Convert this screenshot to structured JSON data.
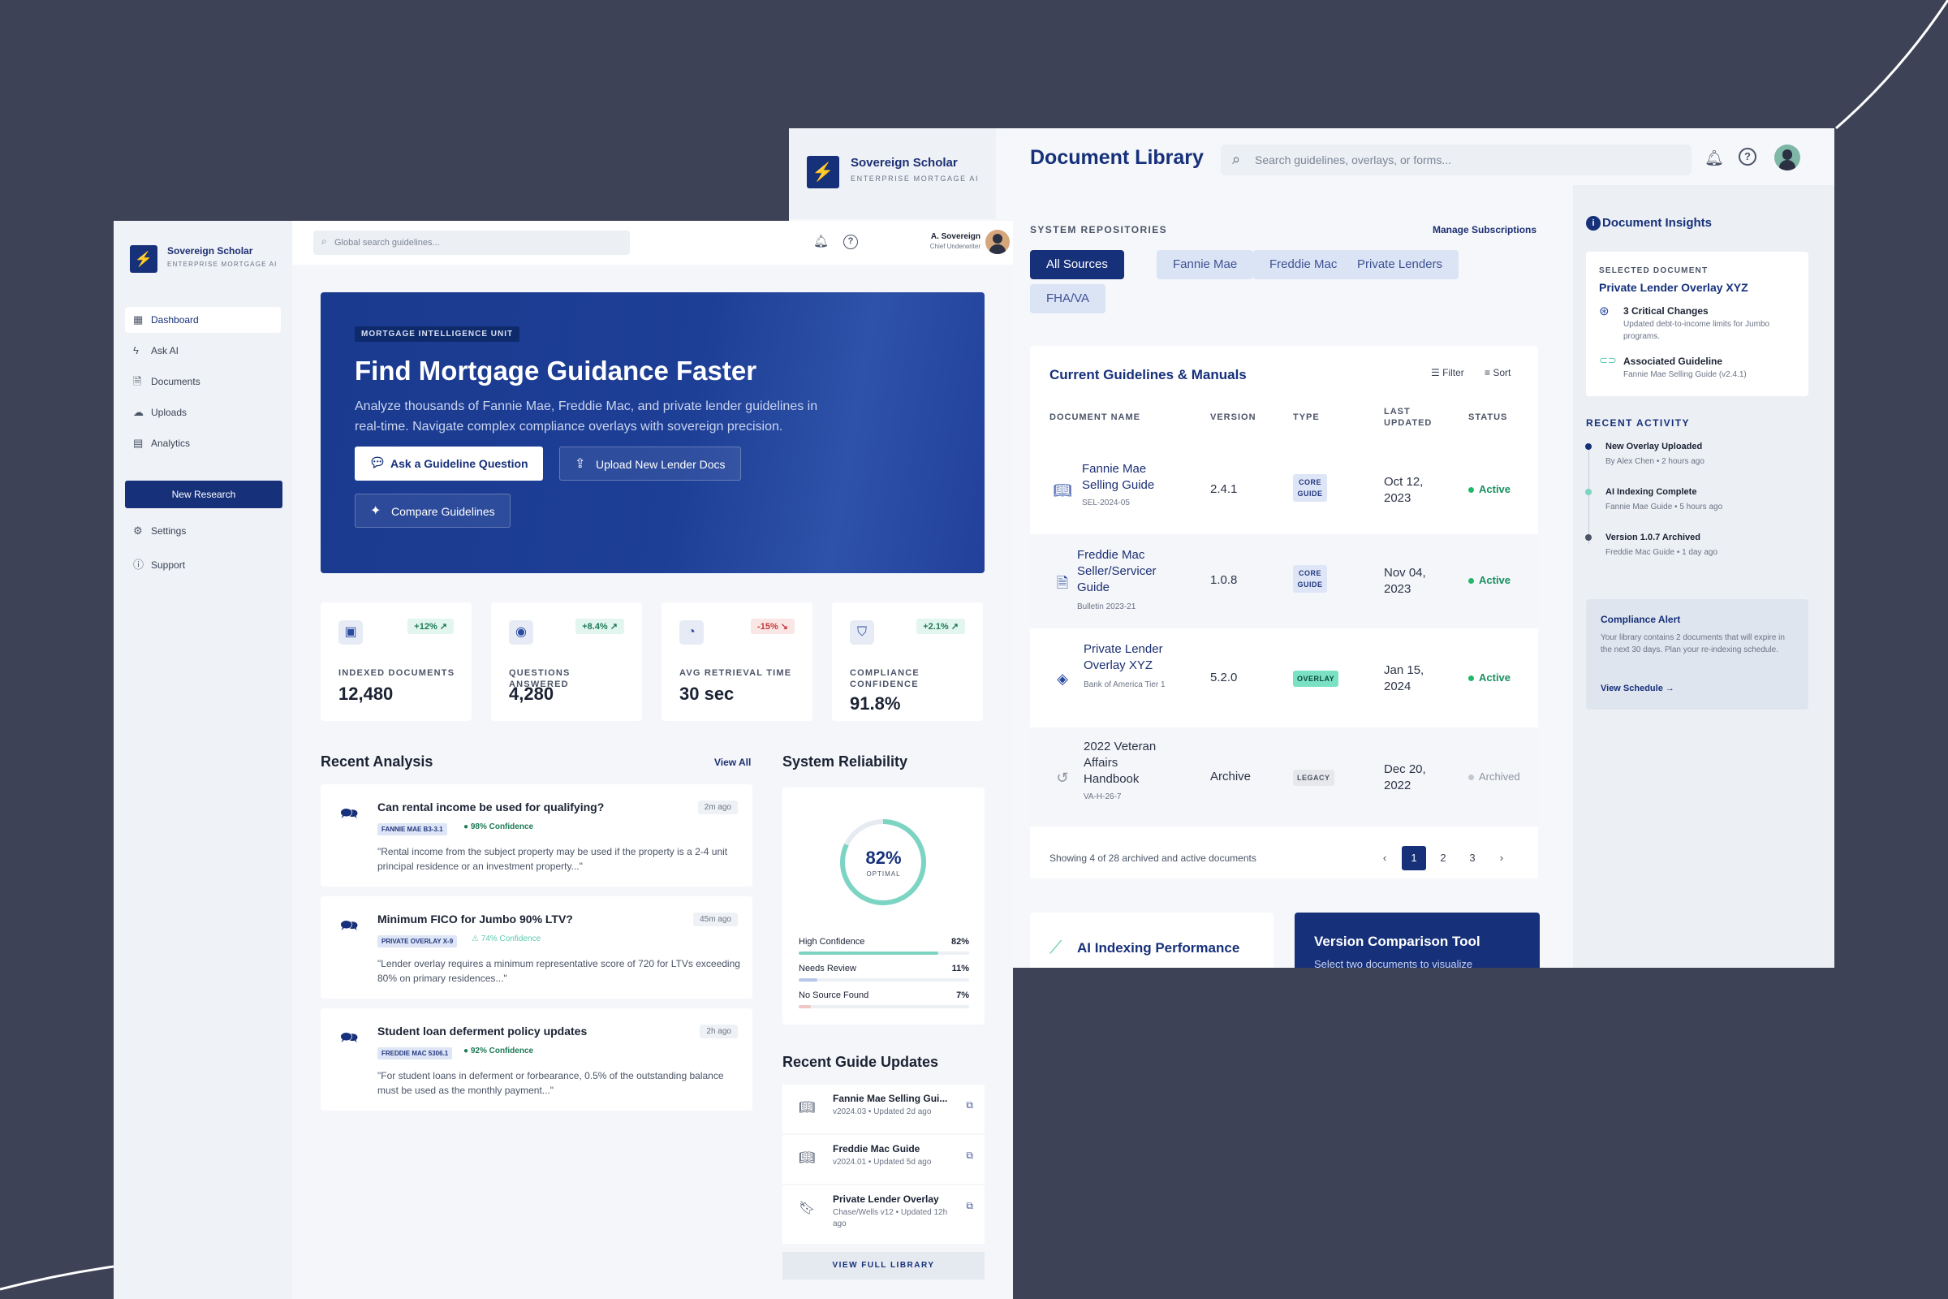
{
  "brand": {
    "name": "Sovereign Scholar",
    "tagline": "ENTERPRISE MORTGAGE AI"
  },
  "library": {
    "title": "Document Library",
    "search_placeholder": "Search guidelines, overlays, or forms...",
    "repos_label": "SYSTEM REPOSITORIES",
    "manage_link": "Manage Subscriptions",
    "chips": [
      "All Sources",
      "Fannie Mae",
      "Freddie Mac",
      "Private Lenders",
      "FHA/VA"
    ],
    "active_chip": "All Sources",
    "table": {
      "title": "Current Guidelines & Manuals",
      "filter": "Filter",
      "sort": "Sort",
      "headers": [
        "DOCUMENT NAME",
        "VERSION",
        "TYPE",
        "LAST UPDATED",
        "STATUS"
      ],
      "rows": [
        {
          "name": "Fannie Mae Selling Guide",
          "sub": "SEL-2024-05",
          "version": "2.4.1",
          "type": "CORE GUIDE",
          "date": "Oct 12, 2023",
          "status": "Active",
          "icon": "book-icon"
        },
        {
          "name": "Freddie Mac Seller/Servicer Guide",
          "sub": "Bulletin 2023-21",
          "version": "1.0.8",
          "type": "CORE GUIDE",
          "date": "Nov 04, 2023",
          "status": "Active",
          "icon": "document-icon"
        },
        {
          "name": "Private Lender Overlay XYZ",
          "sub": "Bank of America Tier 1",
          "version": "5.2.0",
          "type": "OVERLAY",
          "date": "Jan 15, 2024",
          "status": "Active",
          "icon": "layers-icon"
        },
        {
          "name": "2022 Veteran Affairs Handbook",
          "sub": "VA-H-26-7",
          "version": "Archive",
          "type": "LEGACY",
          "date": "Dec 20, 2022",
          "status": "Archived",
          "icon": "history-icon"
        }
      ],
      "footer": "Showing 4 of 28 archived and active documents",
      "pages": [
        "1",
        "2",
        "3"
      ],
      "current_page": "1"
    },
    "ai_perf_title": "AI Indexing Performance",
    "vct": {
      "title": "Version Comparison Tool",
      "sub": "Select two documents to visualize"
    },
    "insights": {
      "title": "Document Insights",
      "selected_label": "SELECTED DOCUMENT",
      "selected_name": "Private Lender Overlay XYZ",
      "changes_title": "3 Critical Changes",
      "changes_sub": "Updated debt-to-income limits for Jumbo programs.",
      "assoc_title": "Associated Guideline",
      "assoc_sub": "Fannie Mae Selling Guide (v2.4.1)",
      "activity_label": "RECENT ACTIVITY",
      "activity": [
        {
          "title": "New Overlay Uploaded",
          "sub": "By Alex Chen • 2 hours ago"
        },
        {
          "title": "AI Indexing Complete",
          "sub": "Fannie Mae Guide • 5 hours ago"
        },
        {
          "title": "Version 1.0.7 Archived",
          "sub": "Freddie Mac Guide • 1 day ago"
        }
      ],
      "alert": {
        "title": "Compliance Alert",
        "body": "Your library contains 2 documents that will expire in the next 30 days. Plan your re-indexing schedule.",
        "link": "View Schedule →"
      }
    }
  },
  "dashboard": {
    "search_placeholder": "Global search guidelines...",
    "user": {
      "name": "A. Sovereign",
      "role": "Chief Underwriter"
    },
    "nav": [
      {
        "label": "Dashboard",
        "icon": "grid-icon"
      },
      {
        "label": "Ask AI",
        "icon": "bolt-icon"
      },
      {
        "label": "Documents",
        "icon": "document-icon"
      },
      {
        "label": "Uploads",
        "icon": "cloud-upload-icon"
      },
      {
        "label": "Analytics",
        "icon": "chart-icon"
      }
    ],
    "new_research": "New Research",
    "settings": "Settings",
    "support": "Support",
    "hero": {
      "badge": "MORTGAGE INTELLIGENCE UNIT",
      "title": "Find Mortgage Guidance Faster",
      "body": "Analyze thousands of Fannie Mae, Freddie Mac, and private lender guidelines in real-time. Navigate complex compliance overlays with sovereign precision.",
      "btn_ask": "Ask a Guideline Question",
      "btn_upload": "Upload New Lender Docs",
      "btn_compare": "Compare Guidelines"
    },
    "stats": [
      {
        "label": "INDEXED DOCUMENTS",
        "value": "12,480",
        "delta": "+12% ↗",
        "trend": "up"
      },
      {
        "label": "QUESTIONS ANSWERED",
        "value": "4,280",
        "delta": "+8.4% ↗",
        "trend": "up"
      },
      {
        "label": "AVG RETRIEVAL TIME",
        "value": "30 sec",
        "delta": "-15% ↘",
        "trend": "down"
      },
      {
        "label": "COMPLIANCE CONFIDENCE",
        "value": "91.8%",
        "delta": "+2.1% ↗",
        "trend": "up"
      }
    ],
    "recent_title": "Recent Analysis",
    "view_all": "View All",
    "analysis": [
      {
        "q": "Can rental income be used for qualifying?",
        "time": "2m ago",
        "src": "FANNIE MAE B3-3.1",
        "conf": "98% Confidence",
        "level": "high",
        "quote": "\"Rental income from the subject property may be used if the property is a 2-4 unit principal residence or an investment property...\""
      },
      {
        "q": "Minimum FICO for Jumbo 90% LTV?",
        "time": "45m ago",
        "src": "PRIVATE OVERLAY X-9",
        "conf": "74% Confidence",
        "level": "medium",
        "quote": "\"Lender overlay requires a minimum representative score of 720 for LTVs exceeding 80% on primary residences...\""
      },
      {
        "q": "Student loan deferment policy updates",
        "time": "2h ago",
        "src": "FREDDIE MAC 5306.1",
        "conf": "92% Confidence",
        "level": "high",
        "quote": "\"For student loans in deferment or forbearance, 0.5% of the outstanding balance must be used as the monthly payment...\""
      }
    ],
    "reliability": {
      "title": "System Reliability",
      "score": 82,
      "score_label": "82%",
      "score_sub": "OPTIMAL",
      "bars": [
        {
          "label": "High Confidence",
          "value": 82,
          "value_label": "82%",
          "color": "#7cd4c3"
        },
        {
          "label": "Needs Review",
          "value": 11,
          "value_label": "11%",
          "color": "#b7c6ea"
        },
        {
          "label": "No Source Found",
          "value": 7,
          "value_label": "7%",
          "color": "#f0c6c6"
        }
      ]
    },
    "updates_title": "Recent Guide Updates",
    "updates": [
      {
        "title": "Fannie Mae Selling Gui...",
        "sub": "v2024.03 • Updated 2d ago",
        "icon": "book-icon"
      },
      {
        "title": "Freddie Mac Guide",
        "sub": "v2024.01 • Updated 5d ago",
        "icon": "book-icon"
      },
      {
        "title": "Private Lender Overlay",
        "sub": "Chase/Wells v12 • Updated 12h ago",
        "icon": "bookmark-icon"
      }
    ],
    "view_full_library": "VIEW FULL LIBRARY"
  }
}
